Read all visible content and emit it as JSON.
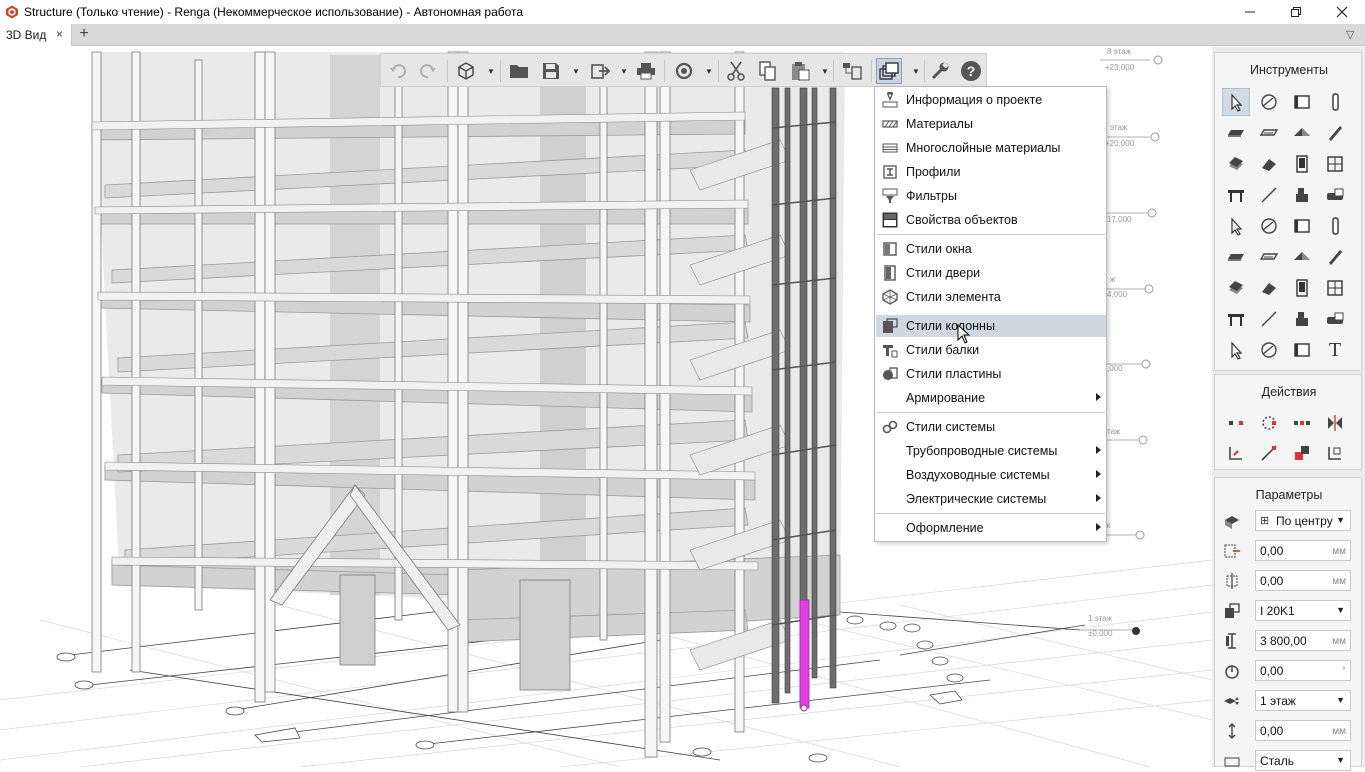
{
  "window": {
    "title": "Structure (Только чтение) - Renga (Некоммерческое использование) - Автономная работа",
    "minimize_icon": "minimize-icon",
    "restore_icon": "restore-icon",
    "close_icon": "close-icon"
  },
  "tabs": [
    {
      "label": "3D Вид",
      "active": true
    }
  ],
  "tab_close": "×",
  "tab_add": "+",
  "tab_overflow": "▽",
  "toolbar": {
    "buttons": [
      "undo-icon",
      "redo-icon",
      "view-cube-icon",
      "open-folder-icon",
      "save-icon",
      "export-icon",
      "print-icon",
      "cloud-sync-icon",
      "cut-icon",
      "copy-icon",
      "paste-icon",
      "layers-icon",
      "styles-icon",
      "settings-icon",
      "help-icon"
    ],
    "help_glyph": "?"
  },
  "menu": {
    "group1": [
      {
        "label": "Информация о проекте",
        "icon": "project-info-icon"
      },
      {
        "label": "Материалы",
        "icon": "materials-icon"
      },
      {
        "label": "Многослойные материалы",
        "icon": "multilayer-materials-icon"
      },
      {
        "label": "Профили",
        "icon": "profiles-icon"
      },
      {
        "label": "Фильтры",
        "icon": "filters-icon"
      },
      {
        "label": "Свойства объектов",
        "icon": "object-properties-icon"
      }
    ],
    "group2": [
      {
        "label": "Стили окна",
        "icon": "window-styles-icon"
      },
      {
        "label": "Стили двери",
        "icon": "door-styles-icon"
      },
      {
        "label": "Стили элемента",
        "icon": "element-styles-icon"
      },
      {
        "label": "Стили колонны",
        "icon": "column-styles-icon",
        "highlighted": true
      },
      {
        "label": "Стили балки",
        "icon": "beam-styles-icon"
      },
      {
        "label": "Стили пластины",
        "icon": "plate-styles-icon"
      },
      {
        "label": "Армирование",
        "icon": "",
        "submenu": true
      }
    ],
    "group3": [
      {
        "label": "Стили системы",
        "icon": "system-styles-icon"
      },
      {
        "label": "Трубопроводные системы",
        "icon": "",
        "submenu": true
      },
      {
        "label": "Воздуховодные системы",
        "icon": "",
        "submenu": true
      },
      {
        "label": "Электрические системы",
        "icon": "",
        "submenu": true
      }
    ],
    "group4": [
      {
        "label": "Оформление",
        "icon": "",
        "submenu": true
      }
    ]
  },
  "levels": [
    {
      "name": "8 этаж",
      "elev": "+23,000"
    },
    {
      "name": "этаж",
      "elev": "+20,000"
    },
    {
      "name": "",
      "elev": "17,000"
    },
    {
      "name": "ж",
      "elev": "4,000"
    },
    {
      "name": "",
      "elev": ",000"
    },
    {
      "name": "таж",
      "elev": ""
    },
    {
      "name": "ж",
      "elev": ""
    },
    {
      "name": "1 этаж",
      "elev": "±0,000"
    }
  ],
  "panels": {
    "tools": {
      "title": "Инструменты",
      "items": [
        "select-icon",
        "axis-icon",
        "wall-icon",
        "column-icon",
        "slab-icon",
        "floor-icon",
        "roof-icon",
        "beam-icon",
        "stair-icon",
        "ramp-icon",
        "door-icon",
        "window-icon",
        "table-icon",
        "line-icon",
        "element-icon",
        "opening-icon",
        "sanitary-icon",
        "equipment-icon",
        "valve-icon",
        "pipe-accessory-icon",
        "pipe-fitting-icon",
        "duct-accessory-icon",
        "duct-fitting-icon",
        "duct-icon",
        "electric-icon",
        "lamp-icon",
        "wire-icon",
        "electric-equipment-icon",
        "room-icon",
        "rebar-icon",
        "route-icon",
        "outlet-icon",
        "dimension-icon",
        "leader-icon",
        "hatch-icon",
        "text-icon"
      ],
      "text_tool_glyph": "T"
    },
    "actions": {
      "title": "Действия",
      "items": [
        "move-icon",
        "rotate-icon",
        "array-icon",
        "mirror-icon",
        "trim-icon",
        "scale-icon",
        "join-icon",
        "split-icon"
      ]
    },
    "params": {
      "title": "Параметры",
      "rows": [
        {
          "icon": "placement-icon",
          "value": "По центру",
          "unit": "",
          "dropdown": true,
          "prefix_icon": true
        },
        {
          "icon": "offset-x-icon",
          "value": "0,00",
          "unit": "мм",
          "dropdown": false
        },
        {
          "icon": "offset-y-icon",
          "value": "0,00",
          "unit": "мм",
          "dropdown": false
        },
        {
          "icon": "profile-icon",
          "value": "I 20K1",
          "unit": "",
          "dropdown": true
        },
        {
          "icon": "height-icon",
          "value": "3 800,00",
          "unit": "мм",
          "dropdown": false
        },
        {
          "icon": "angle-icon",
          "value": "0,00",
          "unit": "°",
          "dropdown": false
        },
        {
          "icon": "level-icon",
          "value": "1 этаж",
          "unit": "",
          "dropdown": true
        },
        {
          "icon": "elevation-offset-icon",
          "value": "0,00",
          "unit": "мм",
          "dropdown": false
        },
        {
          "icon": "material-icon",
          "value": "Сталь",
          "unit": "",
          "dropdown": true
        }
      ]
    }
  },
  "colors": {
    "highlight_column": "#e33ee0",
    "menu_highlight": "#cfd8e0",
    "slab": "#d6d6d6",
    "column": "#f4f4f4"
  }
}
